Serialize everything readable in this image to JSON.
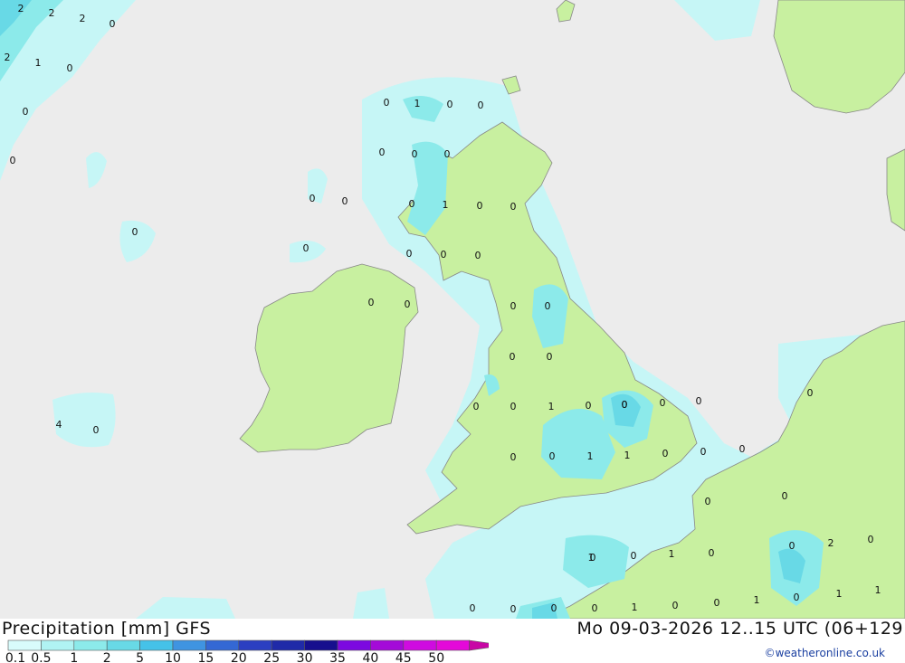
{
  "title_left": "Precipitation [mm] GFS",
  "title_right": "Mo 09-03-2026 12..15 UTC (06+129",
  "credit": "©weatheronline.co.uk",
  "colors": {
    "sea": "#ececec",
    "land": "#c8f0a0",
    "coast": "#888888",
    "label": "#111111",
    "levels": [
      "#d8fbfb",
      "#b0f3f3",
      "#8ceaea",
      "#68d9e6",
      "#45c2e8",
      "#3f94e1",
      "#3468d4",
      "#2b3fc1",
      "#1f2aa8",
      "#160f8e",
      "#7c08e0",
      "#a40ad8",
      "#cf0be0",
      "#e409d9",
      "#c807a5"
    ]
  },
  "legend": {
    "labels": [
      "0.1",
      "0.5",
      "1",
      "2",
      "5",
      "10",
      "15",
      "20",
      "25",
      "30",
      "35",
      "40",
      "45",
      "50"
    ]
  },
  "map_values": [
    "2",
    "2",
    "2",
    "0",
    "2",
    "1",
    "0",
    "0",
    "0",
    "0",
    "1",
    "0",
    "0",
    "0",
    "0",
    "0",
    "0",
    "0",
    "0",
    "1",
    "0",
    "0",
    "0",
    "0",
    "0",
    "0",
    "0",
    "0",
    "0",
    "0",
    "0",
    "0",
    "0",
    "0",
    "0",
    "1",
    "0",
    "0",
    "0",
    "0",
    "0",
    "0",
    "4",
    "0",
    "0",
    "0",
    "1",
    "1",
    "0",
    "0",
    "0",
    "0",
    "0",
    "0",
    "0",
    "1",
    "0",
    "0",
    "2",
    "0",
    "0",
    "0",
    "0",
    "0",
    "1",
    "0",
    "0",
    "1",
    "0",
    "1",
    "1",
    "1",
    "0"
  ]
}
